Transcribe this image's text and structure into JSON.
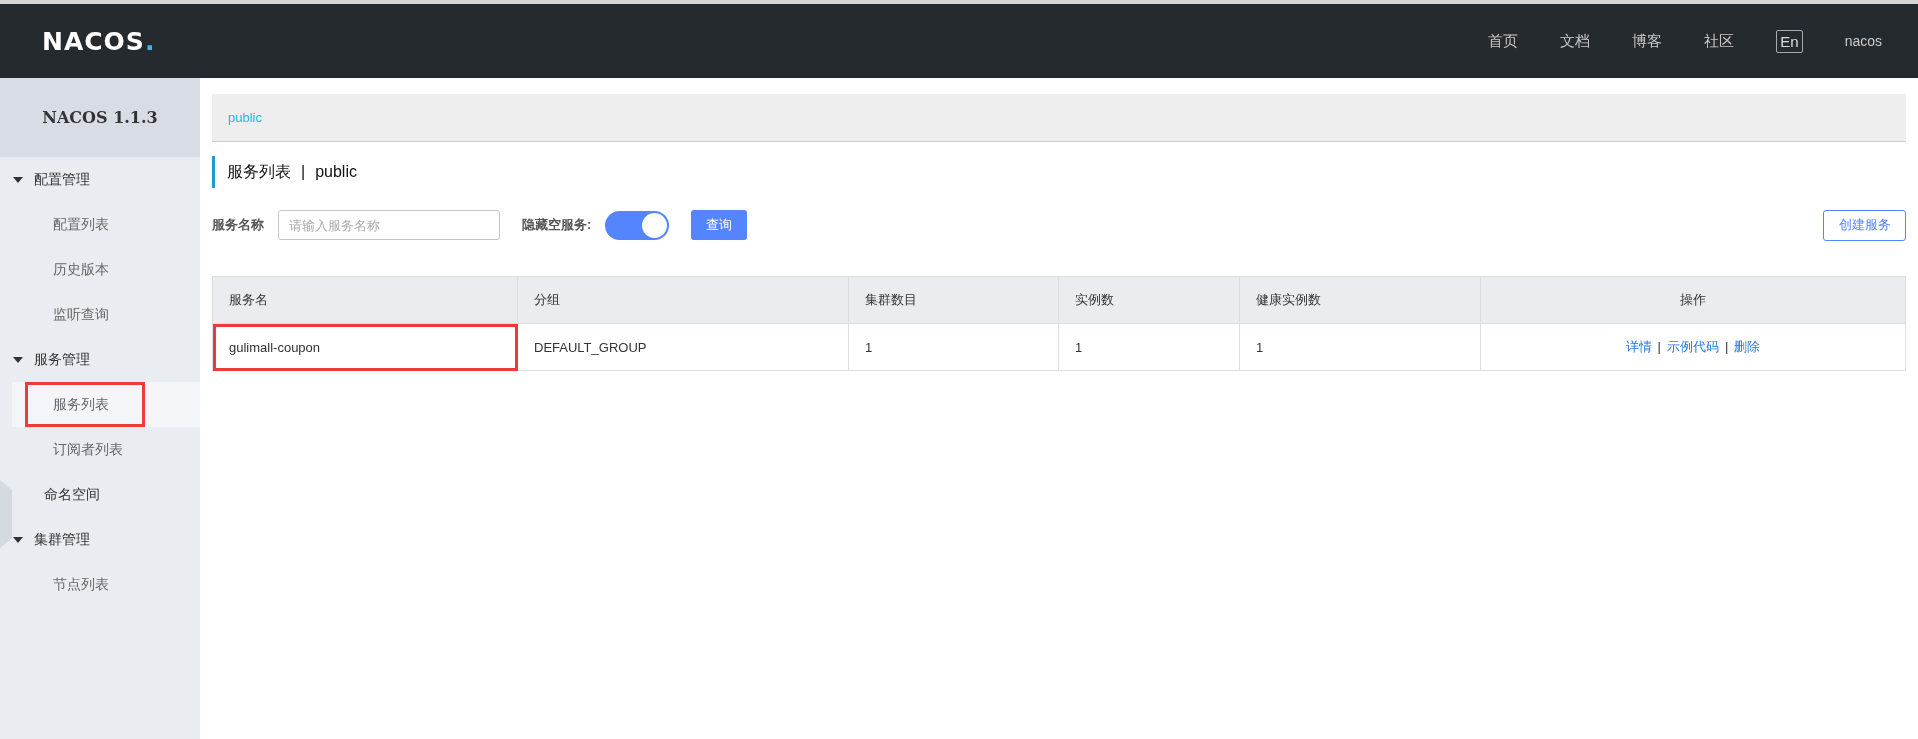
{
  "header": {
    "logo": "NACOS.",
    "nav": [
      "首页",
      "文档",
      "博客",
      "社区"
    ],
    "language": "En",
    "user": "nacos"
  },
  "sidebar": {
    "title": "NACOS 1.1.3",
    "items": [
      {
        "label": "配置管理",
        "expanded": true,
        "children": [
          {
            "label": "配置列表",
            "selected": false,
            "annotated": false
          },
          {
            "label": "历史版本",
            "selected": false,
            "annotated": false
          },
          {
            "label": "监听查询",
            "selected": false,
            "annotated": false
          }
        ]
      },
      {
        "label": "服务管理",
        "expanded": true,
        "children": [
          {
            "label": "服务列表",
            "selected": true,
            "annotated": true
          },
          {
            "label": "订阅者列表",
            "selected": false,
            "annotated": false
          }
        ]
      },
      {
        "label": "命名空间"
      },
      {
        "label": "集群管理",
        "expanded": true,
        "children": [
          {
            "label": "节点列表",
            "selected": false,
            "annotated": false
          }
        ]
      }
    ]
  },
  "namespace_bar": {
    "namespaces": [
      {
        "label": "public",
        "selected": true
      }
    ]
  },
  "page_title": {
    "title": "服务列表",
    "separator": "|",
    "namespace": "public"
  },
  "filter": {
    "name_label": "服务名称",
    "name_placeholder": "请输入服务名称",
    "hide_empty_label": "隐藏空服务:",
    "hide_empty_on": true,
    "query_button": "查询",
    "create_button": "创建服务"
  },
  "table": {
    "columns": [
      "服务名",
      "分组",
      "集群数目",
      "实例数",
      "健康实例数",
      "操作"
    ],
    "rows": [
      {
        "cells": [
          "gulimall-coupon",
          "DEFAULT_GROUP",
          "1",
          "1",
          "1"
        ],
        "annotated": true,
        "actions": [
          "详情",
          "示例代码",
          "删除"
        ]
      }
    ]
  }
}
